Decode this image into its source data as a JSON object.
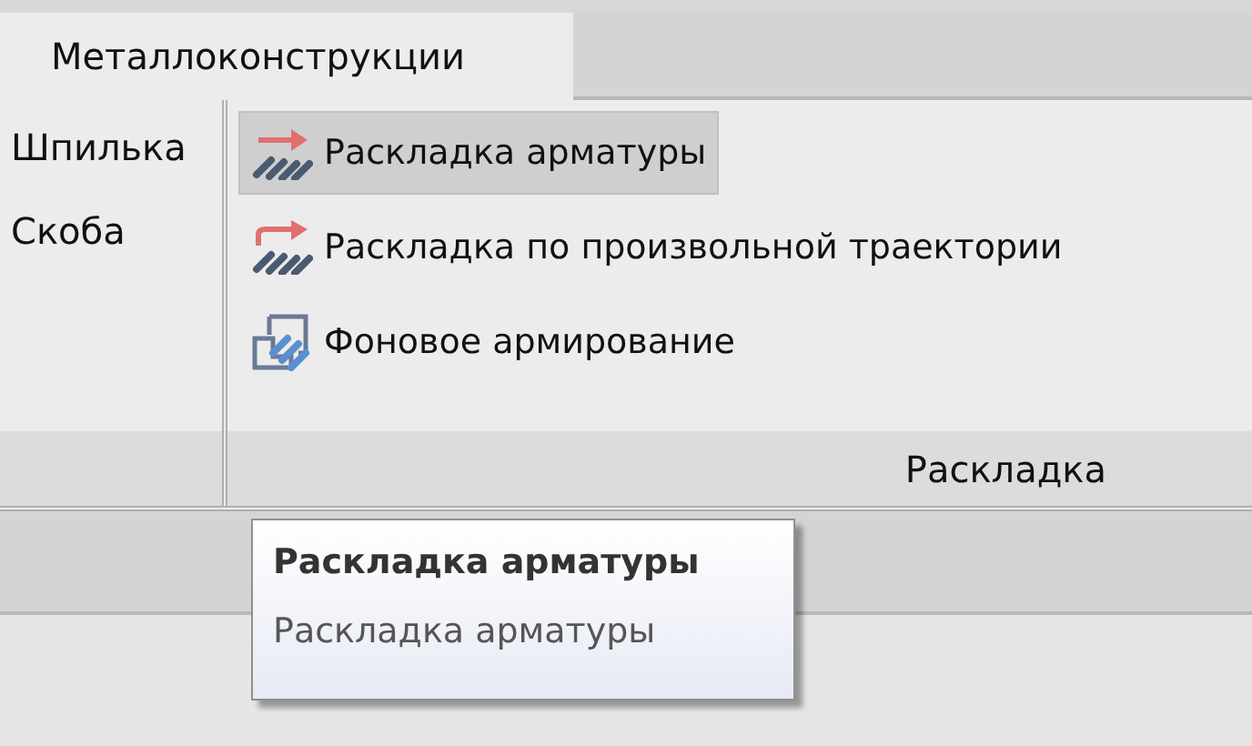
{
  "tabs": [
    {
      "label": "Металлоконструкции",
      "selected": true
    }
  ],
  "left_group": {
    "items": [
      {
        "label": "Шпилька"
      },
      {
        "label": "Скоба"
      }
    ]
  },
  "group": {
    "title": "Раскладка",
    "items": [
      {
        "kind": "straight",
        "label": "Раскладка арматуры",
        "selected": true
      },
      {
        "kind": "curved",
        "label": "Раскладка по произвольной траектории",
        "selected": false
      },
      {
        "kind": "background",
        "label": "Фоновое армирование",
        "selected": false
      }
    ]
  },
  "tooltip": {
    "title": "Раскладка арматуры",
    "description": "Раскладка арматуры"
  }
}
